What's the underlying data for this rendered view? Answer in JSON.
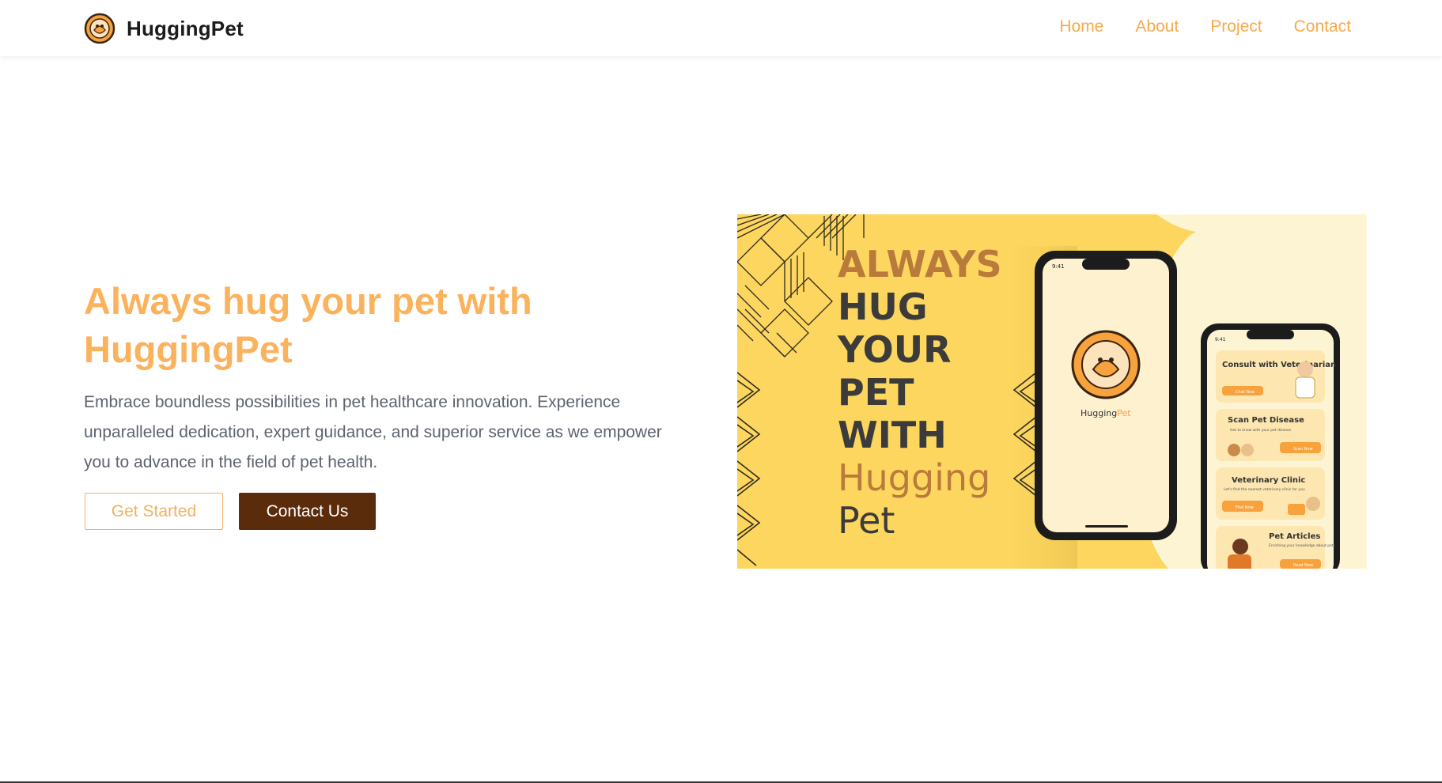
{
  "brand": {
    "name": "HuggingPet",
    "logo_icon": "paw-heart-logo-icon"
  },
  "nav": {
    "items": [
      {
        "label": "Home"
      },
      {
        "label": "About"
      },
      {
        "label": "Project"
      },
      {
        "label": "Contact"
      }
    ]
  },
  "hero": {
    "title": "Always hug your pet with HuggingPet",
    "description": "Embrace boundless possibilities in pet healthcare innovation. Experience unparalleled dedication, expert guidance, and superior service as we empower you to advance in the field of pet health.",
    "primary_button": "Get Started",
    "secondary_button": "Contact Us"
  },
  "banner": {
    "headline": [
      "ALWAYS",
      "HUG",
      "YOUR",
      "PET",
      "WITH"
    ],
    "headline_brand": [
      "Hugging",
      "Pet"
    ],
    "phone_time": "9:41",
    "app_name_a": "Hugging",
    "app_name_b": "Pet",
    "cards": [
      {
        "title": "Consult with Veterinarian",
        "button": "Chat Now"
      },
      {
        "title": "Scan Pet Disease",
        "subtitle": "Get to know with your pet disease",
        "button": "Scan Now"
      },
      {
        "title": "Veterinary Clinic",
        "subtitle": "Let's find the nearest veterinary clinic for you",
        "button": "Find Now"
      },
      {
        "title": "Pet Articles",
        "subtitle": "Enriching your knowledge about pets",
        "button": "Read Now"
      }
    ]
  },
  "colors": {
    "accent": "#fbb25d",
    "brown": "#5b2c0b",
    "banner_yellow": "#fcd65e",
    "banner_cream": "#fdf4d4",
    "text_muted": "#5d6370"
  }
}
